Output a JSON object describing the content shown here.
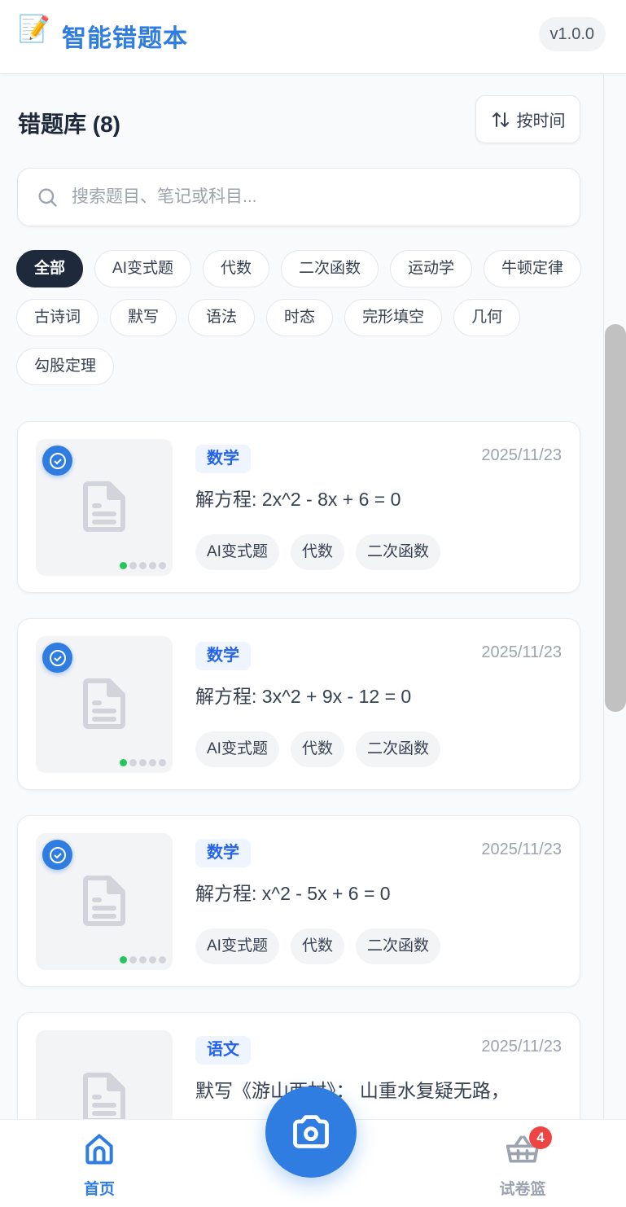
{
  "header": {
    "logo_emoji": "📝",
    "title": "智能错题本",
    "version": "v1.0.0"
  },
  "library": {
    "title": "错题库 (8)",
    "sort_label": "按时间"
  },
  "search": {
    "placeholder": "搜索题目、笔记或科目..."
  },
  "filters": [
    "全部",
    "AI变式题",
    "代数",
    "二次函数",
    "运动学",
    "牛顿定律",
    "古诗词",
    "默写",
    "语法",
    "时态",
    "完形填空",
    "几何",
    "勾股定理"
  ],
  "cards": [
    {
      "subject": "数学",
      "date": "2025/11/23",
      "title": "解方程: 2x^2 - 8x + 6 = 0",
      "tags": [
        "AI变式题",
        "代数",
        "二次函数"
      ],
      "selected": true
    },
    {
      "subject": "数学",
      "date": "2025/11/23",
      "title": "解方程: 3x^2 + 9x - 12 = 0",
      "tags": [
        "AI变式题",
        "代数",
        "二次函数"
      ],
      "selected": true
    },
    {
      "subject": "数学",
      "date": "2025/11/23",
      "title": "解方程: x^2 - 5x + 6 = 0",
      "tags": [
        "AI变式题",
        "代数",
        "二次函数"
      ],
      "selected": true
    },
    {
      "subject": "语文",
      "date": "2025/11/23",
      "title": "默写《游山西村》： 山重水复疑无路，",
      "tags": [],
      "selected": false
    }
  ],
  "nav": {
    "home_label": "首页",
    "basket_label": "试卷篮",
    "basket_count": "4"
  },
  "colors": {
    "accent": "#2f7de1",
    "dark": "#1e293b",
    "badge": "#ef4444",
    "dot_active": "#22c55e"
  }
}
